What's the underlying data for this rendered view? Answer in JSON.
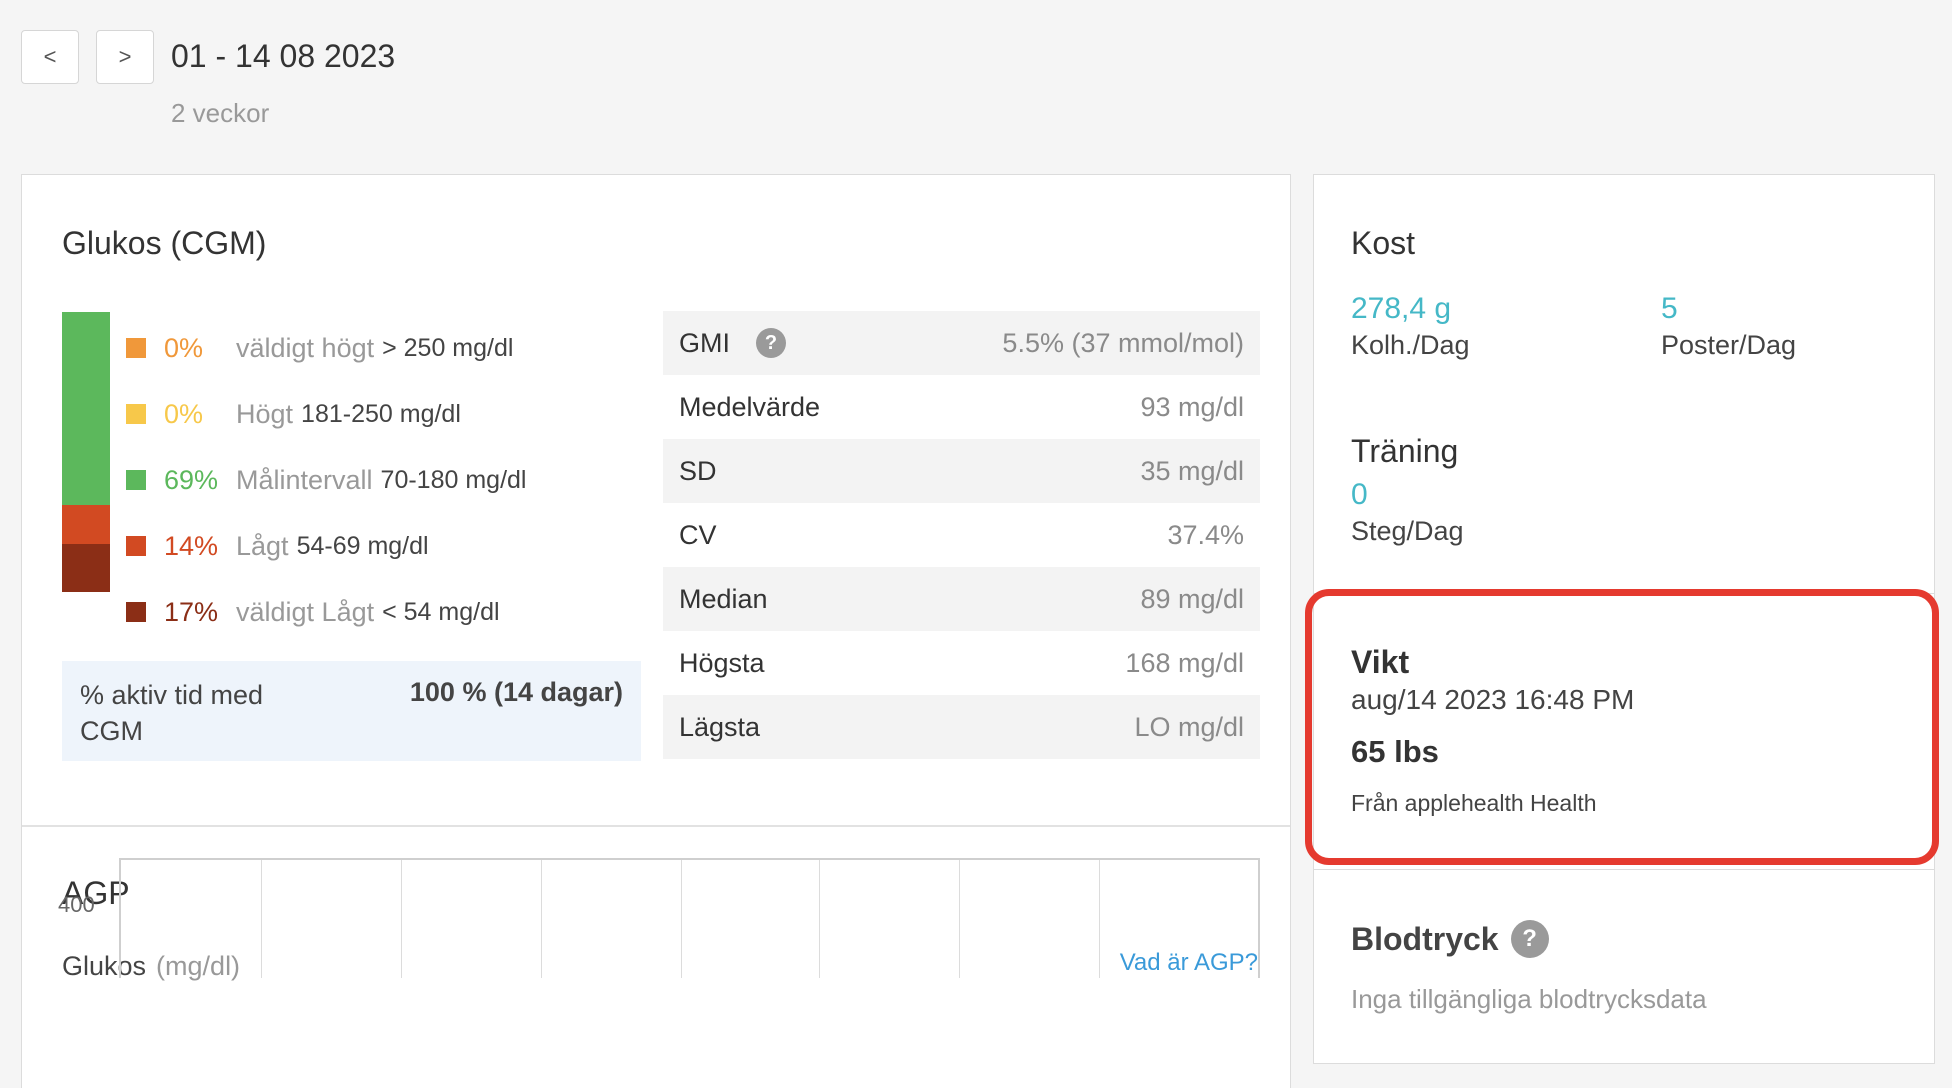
{
  "header": {
    "prev_label": "<",
    "next_label": ">",
    "period": "01 - 14 08 2023",
    "duration": "2 veckor"
  },
  "glucose": {
    "title": "Glukos (CGM)",
    "ranges": [
      {
        "pct_label": "0%",
        "pct": 0,
        "name": "väldigt högt",
        "range": "> 250 mg/dl",
        "color": "#f0983a"
      },
      {
        "pct_label": "0%",
        "pct": 0,
        "name": "Högt",
        "range": "181-250 mg/dl",
        "color": "#f7c84a"
      },
      {
        "pct_label": "69%",
        "pct": 69,
        "name": "Målintervall",
        "range": "70-180 mg/dl",
        "color": "#5cb85c"
      },
      {
        "pct_label": "14%",
        "pct": 14,
        "name": "Lågt",
        "range": "54-69 mg/dl",
        "color": "#d24a22"
      },
      {
        "pct_label": "17%",
        "pct": 17,
        "name": "väldigt Lågt",
        "range": "< 54 mg/dl",
        "color": "#8b2e16"
      }
    ],
    "active_label": "% aktiv tid med CGM",
    "active_value": "100 % (14 dagar)",
    "stats": [
      {
        "label": "GMI",
        "value": "5.5% (37 mmol/mol)",
        "help": true
      },
      {
        "label": "Medelvärde",
        "value": "93 mg/dl"
      },
      {
        "label": "SD",
        "value": "35 mg/dl"
      },
      {
        "label": "CV",
        "value": "37.4%"
      },
      {
        "label": "Median",
        "value": "89 mg/dl"
      },
      {
        "label": "Högsta",
        "value": "168 mg/dl"
      },
      {
        "label": "Lägsta",
        "value": "LO mg/dl"
      }
    ]
  },
  "agp": {
    "title": "AGP",
    "glucose_label": "Glukos",
    "unit": "(mg/dl)",
    "link": "Vad är AGP?",
    "y_tick": "400"
  },
  "kost": {
    "title": "Kost",
    "carbs_value": "278,4 g",
    "carbs_label": "Kolh./Dag",
    "entries_value": "5",
    "entries_label": "Poster/Dag"
  },
  "training": {
    "title": "Träning",
    "steps_value": "0",
    "steps_label": "Steg/Dag"
  },
  "weight": {
    "title": "Vikt",
    "date": "aug/14 2023 16:48 PM",
    "value": "65 lbs",
    "source": "Från applehealth Health"
  },
  "blood_pressure": {
    "title": "Blodtryck",
    "empty": "Inga tillgängliga blodtrycksdata"
  },
  "colors": {
    "teal": "#45b8c7",
    "highlight": "#e53a2f",
    "link": "#3a9ad9"
  },
  "icons": {
    "help": "?"
  }
}
